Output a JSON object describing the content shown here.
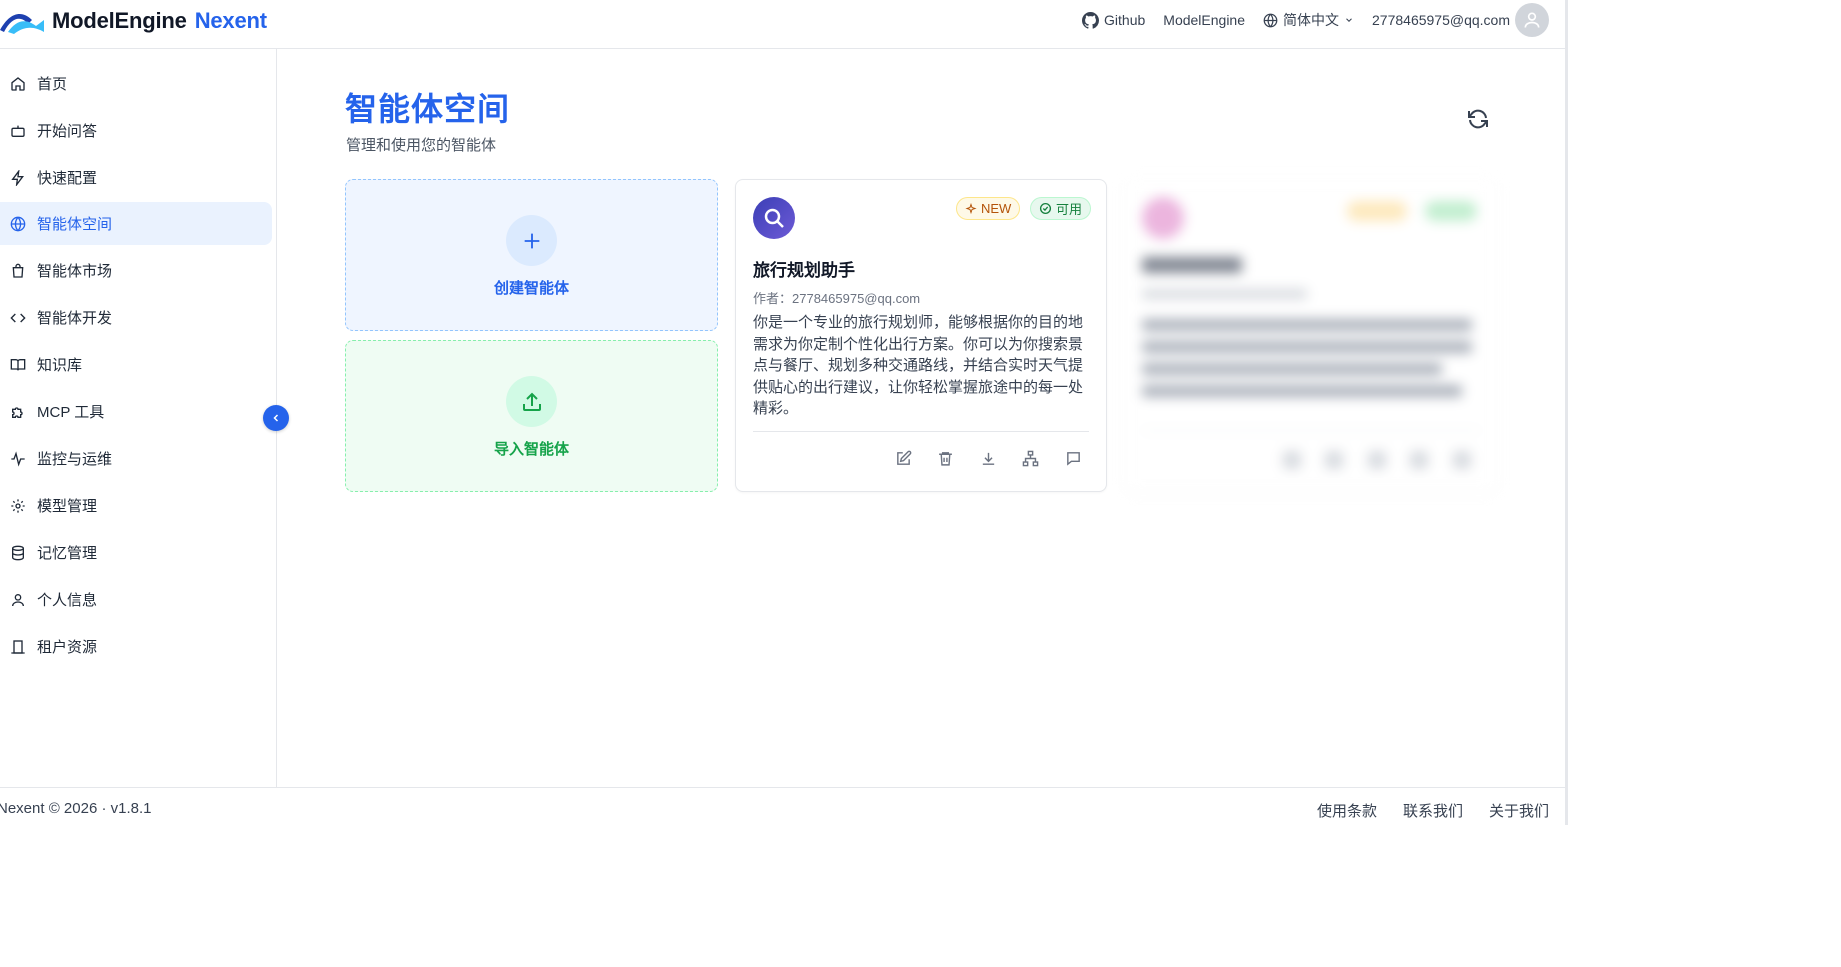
{
  "header": {
    "brand": "ModelEngine",
    "brand_accent": "Nexent",
    "links": {
      "github": "Github",
      "modelengine": "ModelEngine",
      "language": "简体中文",
      "user_email": "2778465975@qq.com"
    }
  },
  "sidebar": {
    "items": [
      {
        "label": "首页",
        "icon": "home-icon"
      },
      {
        "label": "开始问答",
        "icon": "bot-icon"
      },
      {
        "label": "快速配置",
        "icon": "bolt-icon"
      },
      {
        "label": "智能体空间",
        "icon": "globe-icon",
        "active": true
      },
      {
        "label": "智能体市场",
        "icon": "shopping-bag-icon"
      },
      {
        "label": "智能体开发",
        "icon": "code-icon"
      },
      {
        "label": "知识库",
        "icon": "book-icon"
      },
      {
        "label": "MCP 工具",
        "icon": "puzzle-icon"
      },
      {
        "label": "监控与运维",
        "icon": "activity-icon"
      },
      {
        "label": "模型管理",
        "icon": "gear-icon"
      },
      {
        "label": "记忆管理",
        "icon": "database-icon"
      },
      {
        "label": "个人信息",
        "icon": "user-icon"
      },
      {
        "label": "租户资源",
        "icon": "building-icon"
      }
    ]
  },
  "main": {
    "title": "智能体空间",
    "subtitle": "管理和使用您的智能体",
    "create_label": "创建智能体",
    "import_label": "导入智能体",
    "agent": {
      "name": "旅行规划助手",
      "badge_new": "NEW",
      "badge_status": "可用",
      "author": "作者：2778465975@qq.com",
      "description": "你是一个专业的旅行规划师，能够根据你的目的地需求为你定制个性化出行方案。你可以为你搜索景点与餐厅、规划多种交通路线，并结合实时天气提供贴心的出行建议，让你轻松掌握旅途中的每一处精彩。",
      "actions": [
        "edit-icon",
        "trash-icon",
        "download-icon",
        "sitemap-icon",
        "chat-icon"
      ]
    }
  },
  "footer": {
    "copyright": "Nexent © 2026 · v1.8.1",
    "terms": "使用条款",
    "contact": "联系我们",
    "about": "关于我们"
  },
  "colors": {
    "primary": "#2563eb",
    "success": "#16a34a",
    "active_bg": "#eaf2fe"
  }
}
